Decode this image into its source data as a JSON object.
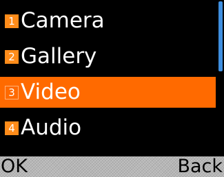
{
  "menu": {
    "items": [
      {
        "number": "1",
        "label": "Camera"
      },
      {
        "number": "2",
        "label": "Gallery"
      },
      {
        "number": "3",
        "label": "Video"
      },
      {
        "number": "4",
        "label": "Audio"
      }
    ],
    "selected_index": 2
  },
  "softkeys": {
    "left": "OK",
    "right": "Back"
  },
  "colors": {
    "background": "#000000",
    "highlight": "#ff6a00",
    "badge": "#ff8c1a",
    "scrollbar": "#3f8fe0",
    "softkey_bar": "#b7b7b7"
  }
}
